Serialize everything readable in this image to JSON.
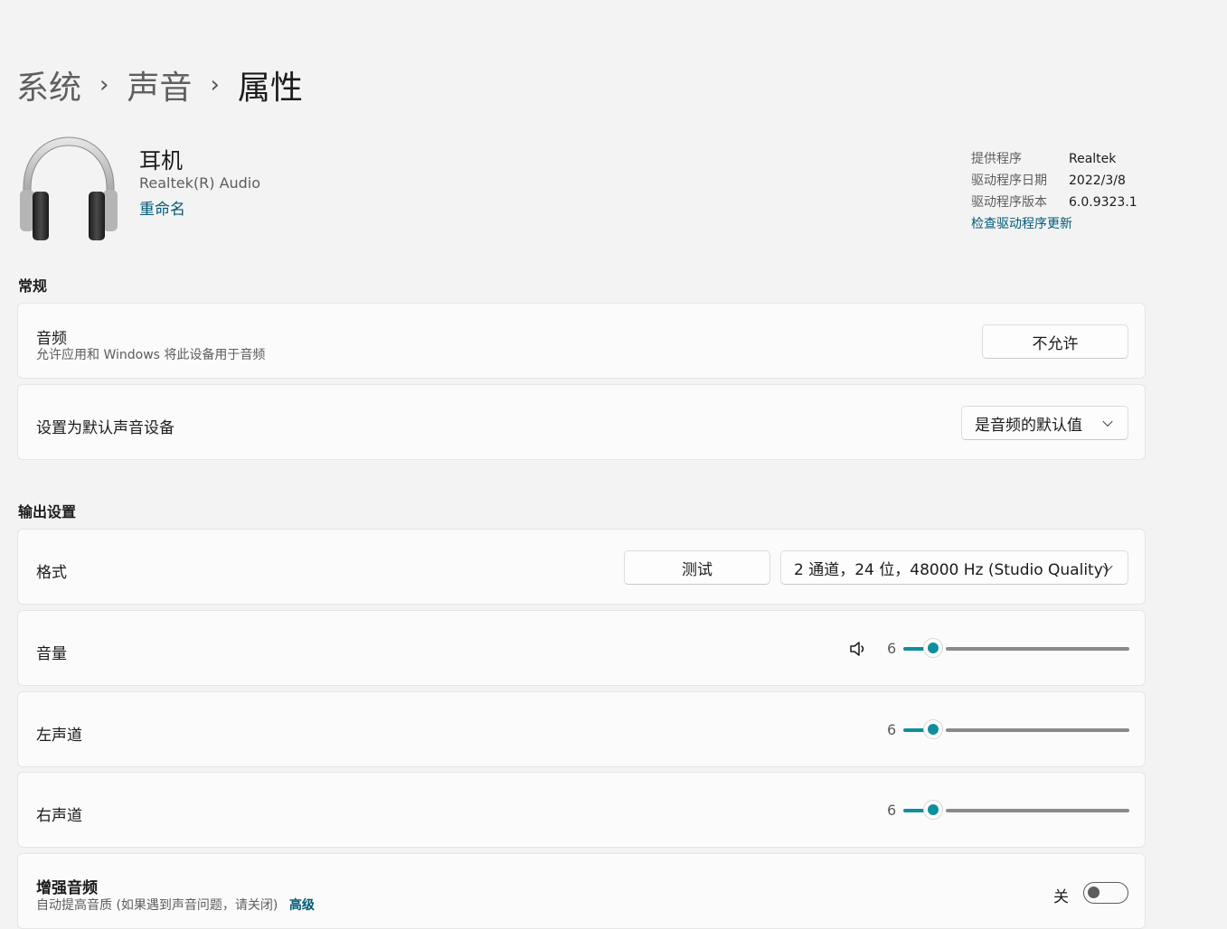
{
  "breadcrumb": {
    "items": [
      "系统",
      "声音"
    ],
    "current": "属性",
    "separator": "›"
  },
  "device": {
    "name": "耳机",
    "subtitle": "Realtek(R) Audio",
    "rename_link": "重命名",
    "icon": "headphones-icon"
  },
  "driver": {
    "provider_label": "提供程序",
    "provider_value": "Realtek",
    "date_label": "驱动程序日期",
    "date_value": "2022/3/8",
    "version_label": "驱动程序版本",
    "version_value": "6.0.9323.1",
    "update_link": "检查驱动程序更新"
  },
  "general": {
    "section_title": "常规",
    "audio": {
      "title": "音频",
      "description": "允许应用和 Windows 将此设备用于音频",
      "button": "不允许"
    },
    "default_device": {
      "title": "设置为默认声音设备",
      "dropdown": "是音频的默认值"
    }
  },
  "output": {
    "section_title": "输出设置",
    "format": {
      "title": "格式",
      "test_button": "测试",
      "dropdown": "2 通道，24 位，48000 Hz (Studio Quality)"
    },
    "volume": {
      "title": "音量",
      "value": "6",
      "level": 6,
      "max": 100,
      "icon": "speaker-icon"
    },
    "left_channel": {
      "title": "左声道",
      "value": "6",
      "level": 6,
      "max": 100
    },
    "right_channel": {
      "title": "右声道",
      "value": "6",
      "level": 6,
      "max": 100
    },
    "enhance": {
      "title": "增强音频",
      "description": "自动提高音质 (如果遇到声音问题，请关闭)",
      "advanced_link": "高级",
      "toggle_label": "关",
      "toggle_on": false
    }
  },
  "colors": {
    "accent": "#0e8f9c",
    "link": "#005a76",
    "background": "#f3f3f3",
    "card": "#fbfbfb"
  }
}
